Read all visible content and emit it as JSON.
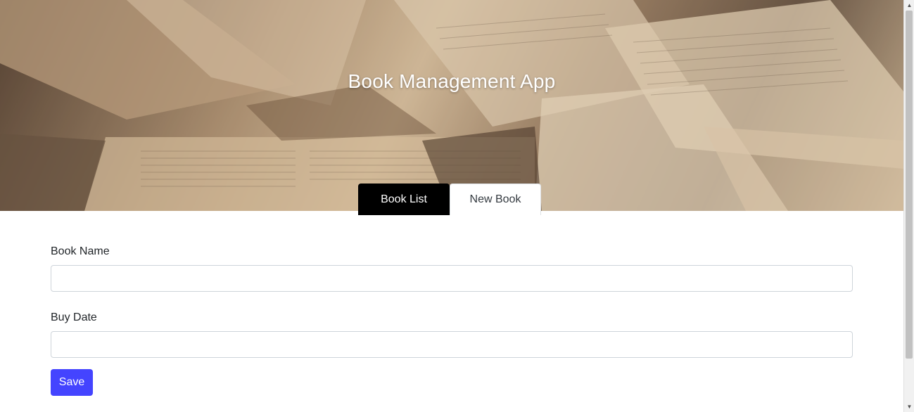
{
  "app": {
    "title": "Book Management App"
  },
  "tabs": [
    {
      "label": "Book List",
      "active": true
    },
    {
      "label": "New Book",
      "active": false
    }
  ],
  "form": {
    "book_name": {
      "label": "Book Name",
      "value": "",
      "placeholder": ""
    },
    "buy_date": {
      "label": "Buy Date",
      "value": "",
      "placeholder": ""
    },
    "save_label": "Save"
  },
  "colors": {
    "tab_active_bg": "#000000",
    "save_button_bg": "#4444ff"
  },
  "icons": {
    "scroll_up": "scroll-up-arrow-icon",
    "scroll_down": "scroll-down-arrow-icon"
  }
}
